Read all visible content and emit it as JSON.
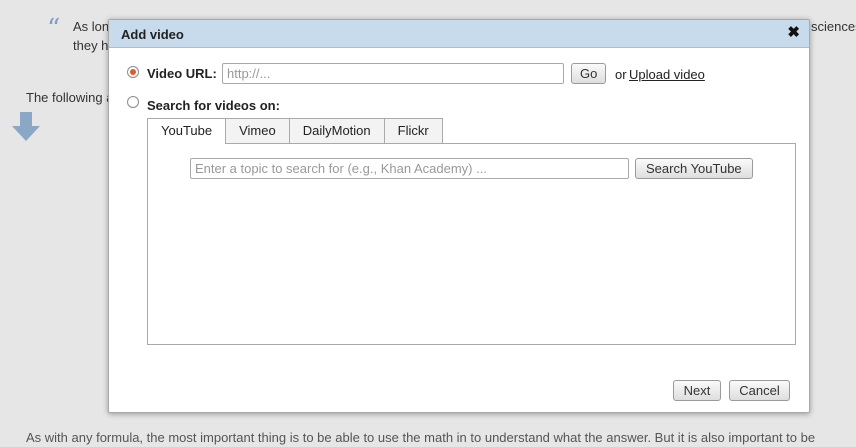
{
  "background": {
    "quote_line1": "As lon",
    "quote_line1_right": "sciences",
    "quote_line2": "they h",
    "following": "The following a",
    "bottom_line": "As with any formula, the most important thing is to be able to use the math in to understand what the answer. But it is also important to be"
  },
  "dialog": {
    "title": "Add video",
    "close_glyph": "✖",
    "video_url": {
      "label": "Video URL:",
      "placeholder": "http://...",
      "go_label": "Go",
      "or_text": "or",
      "upload_label": "Upload video"
    },
    "search": {
      "label": "Search for videos on:",
      "tabs": [
        "YouTube",
        "Vimeo",
        "DailyMotion",
        "Flickr"
      ],
      "active_tab": "YouTube",
      "placeholder": "Enter a topic to search for (e.g., Khan Academy) ...",
      "button_label": "Search YouTube"
    },
    "footer": {
      "next_label": "Next",
      "cancel_label": "Cancel"
    }
  },
  "colors": {
    "header_bg": "#c7dbec",
    "radio_selected": "#e35a2a",
    "overlay_bg": "#e6e6e6"
  }
}
